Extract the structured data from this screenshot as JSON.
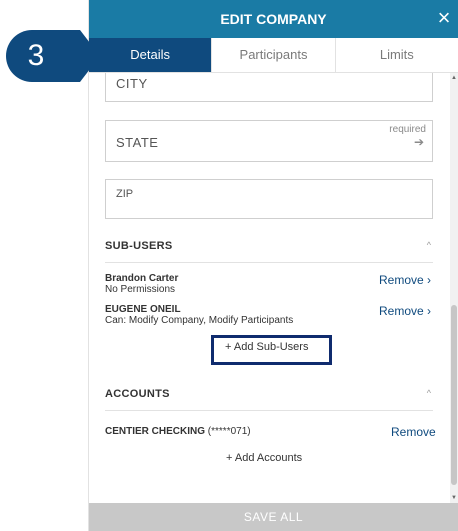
{
  "step_badge": {
    "number": "3"
  },
  "header": {
    "title": "EDIT COMPANY",
    "close_icon": "×"
  },
  "tabs": [
    {
      "label": "Details",
      "active": true
    },
    {
      "label": "Participants",
      "active": false
    },
    {
      "label": "Limits",
      "active": false
    }
  ],
  "fields": {
    "city": {
      "label": "CITY"
    },
    "state": {
      "label": "STATE",
      "required_text": "required",
      "arrow_icon": "➔"
    },
    "zip": {
      "label": "ZIP"
    }
  },
  "sub_users": {
    "title": "SUB-USERS",
    "caret_icon": "^",
    "users": [
      {
        "name": "Brandon Carter",
        "detail": "No Permissions",
        "action": "Remove ›"
      },
      {
        "name": "EUGENE ONEIL",
        "detail": "Can: Modify Company, Modify Participants",
        "action": "Remove ›"
      }
    ],
    "add_label": "+  Add Sub-Users"
  },
  "accounts": {
    "title": "ACCOUNTS",
    "caret_icon": "^",
    "items": [
      {
        "name": "CENTIER CHECKING",
        "masked": " (*****071)",
        "action": "Remove"
      }
    ],
    "add_label": "+   Add Accounts"
  },
  "footer": {
    "save_label": "SAVE ALL"
  },
  "scrollbar": {
    "up_icon": "▲",
    "down_icon": "▼"
  },
  "colors": {
    "header": "#1a7ba5",
    "active_tab": "#0f4a7e",
    "badge": "#0f4a7e",
    "link": "#0f4a7e",
    "footer": "#c8c8c8"
  }
}
